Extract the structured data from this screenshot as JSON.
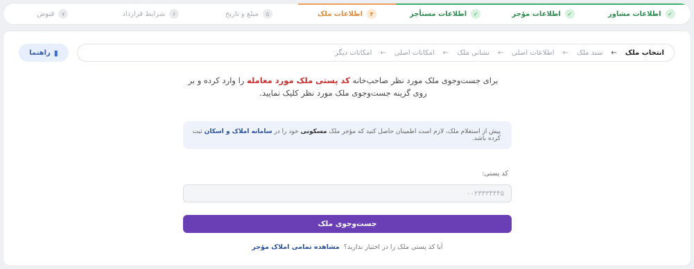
{
  "stepper": {
    "steps": [
      {
        "label": "اطلاعات مشاور",
        "badge": "✓",
        "state": "done"
      },
      {
        "label": "اطلاعات مؤجر",
        "badge": "✓",
        "state": "done"
      },
      {
        "label": "اطلاعات مستأجر",
        "badge": "✓",
        "state": "done"
      },
      {
        "label": "اطلاعات ملک",
        "badge": "۴",
        "state": "active"
      },
      {
        "label": "مبلغ و تاریخ",
        "badge": "۵",
        "state": "pending"
      },
      {
        "label": "شرایط قرارداد",
        "badge": "۶",
        "state": "pending"
      },
      {
        "label": "قبوض",
        "badge": "۷",
        "state": "pending"
      }
    ]
  },
  "toolbar": {
    "help_label": "راهنما",
    "help_icon": "book-icon"
  },
  "breadcrumb": {
    "items": [
      "انتخاب ملک",
      "سند ملک",
      "اطلاعات اصلی",
      "نشانی ملک",
      "امکانات اصلی",
      "امکانات دیگر"
    ],
    "arrow": "←"
  },
  "intro": {
    "part1": "برای جست‌وجوی ملک مورد نظر صاحب‌خانه ",
    "highlight": "کد پستی ملک مورد معامله",
    "part2": " را وارد کرده و بر روی گزینه جست‌وجوی ملک مورد نظر کلیک نمایید."
  },
  "notice": {
    "part1": "پیش از استعلام ملک، لازم است اطمینان حاصل کنید که مؤجر ملک ",
    "bold": "مسکونی",
    "part2": " خود را در ",
    "link": "سامانه املاک و اسکان",
    "part3": " ثبت کرده باشد."
  },
  "form": {
    "postal_label": "کد پستی:",
    "postal_placeholder": "۰۰۲۳۳۳۴۴۴۵",
    "search_label": "جست‌وجوی ملک"
  },
  "footer": {
    "question": "آیا کد پستی ملک را در اختیار ندارید؟",
    "link": "مشاهده تمامی املاک مؤجر"
  },
  "colors": {
    "primary": "#6a3fb5",
    "done": "#3fb36a",
    "active": "#e0893a",
    "highlight": "#c62f2f",
    "link": "#2b4f9a"
  }
}
